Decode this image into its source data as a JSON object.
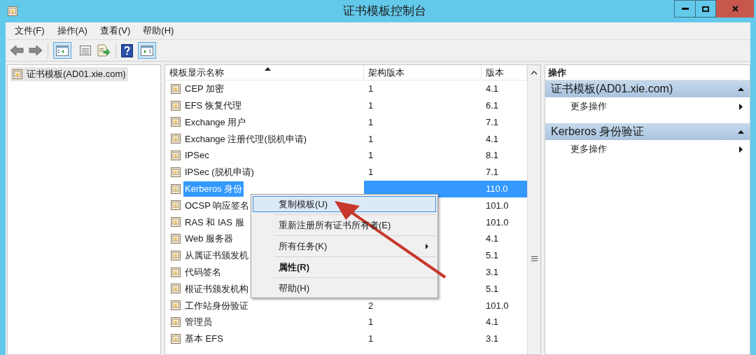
{
  "window": {
    "title": "证书模板控制台"
  },
  "menu_bar": [
    "文件(F)",
    "操作(A)",
    "查看(V)",
    "帮助(H)"
  ],
  "tree": [
    {
      "label": "证书模板(AD01.xie.com)",
      "selected": true
    }
  ],
  "table": {
    "columns": [
      {
        "label": "模板显示名称",
        "sorted": true
      },
      {
        "label": "架构版本",
        "sorted": false
      },
      {
        "label": "版本",
        "sorted": false
      }
    ],
    "rows": [
      {
        "name": "CEP 加密",
        "schema": "1",
        "version": "4.1",
        "selected": false
      },
      {
        "name": "EFS 恢复代理",
        "schema": "1",
        "version": "6.1",
        "selected": false
      },
      {
        "name": "Exchange 用户",
        "schema": "1",
        "version": "7.1",
        "selected": false
      },
      {
        "name": "Exchange 注册代理(脱机申请)",
        "schema": "1",
        "version": "4.1",
        "selected": false
      },
      {
        "name": "IPSec",
        "schema": "1",
        "version": "8.1",
        "selected": false
      },
      {
        "name": "IPSec (脱机申请)",
        "schema": "1",
        "version": "7.1",
        "selected": false
      },
      {
        "name": "Kerberos 身份",
        "version": "110.0",
        "selected": true
      },
      {
        "name": "OCSP 响应签名",
        "version": "101.0",
        "selected": false
      },
      {
        "name": "RAS 和 IAS 服",
        "version": "101.0",
        "selected": false
      },
      {
        "name": "Web 服务器",
        "version": "4.1",
        "selected": false
      },
      {
        "name": "从属证书颁发机",
        "version": "5.1",
        "selected": false
      },
      {
        "name": "代码签名",
        "version": "3.1",
        "selected": false
      },
      {
        "name": "根证书颁发机构",
        "version": "5.1",
        "selected": false
      },
      {
        "name": "工作站身份验证",
        "schema": "2",
        "version": "101.0",
        "selected": false
      },
      {
        "name": "管理员",
        "schema": "1",
        "version": "4.1",
        "selected": false
      },
      {
        "name": "基本 EFS",
        "schema": "1",
        "version": "3.1",
        "selected": false
      }
    ]
  },
  "context_menu": [
    {
      "label": "复制模板(U)",
      "kind": "item",
      "selected": true
    },
    {
      "label": "重新注册所有证书所有者(E)",
      "kind": "item",
      "selected": false
    },
    {
      "label": "所有任务(K)",
      "kind": "submenu",
      "selected": false
    },
    {
      "label": "属性(R)",
      "kind": "default",
      "selected": false
    },
    {
      "label": "帮助(H)",
      "kind": "item",
      "selected": false
    }
  ],
  "actions": {
    "title": "操作",
    "sections": [
      {
        "title": "证书模板(AD01.xie.com)",
        "expanded": true,
        "items": [
          "更多操作"
        ]
      },
      {
        "title": "Kerberos 身份验证",
        "expanded": true,
        "items": [
          "更多操作"
        ]
      }
    ]
  }
}
